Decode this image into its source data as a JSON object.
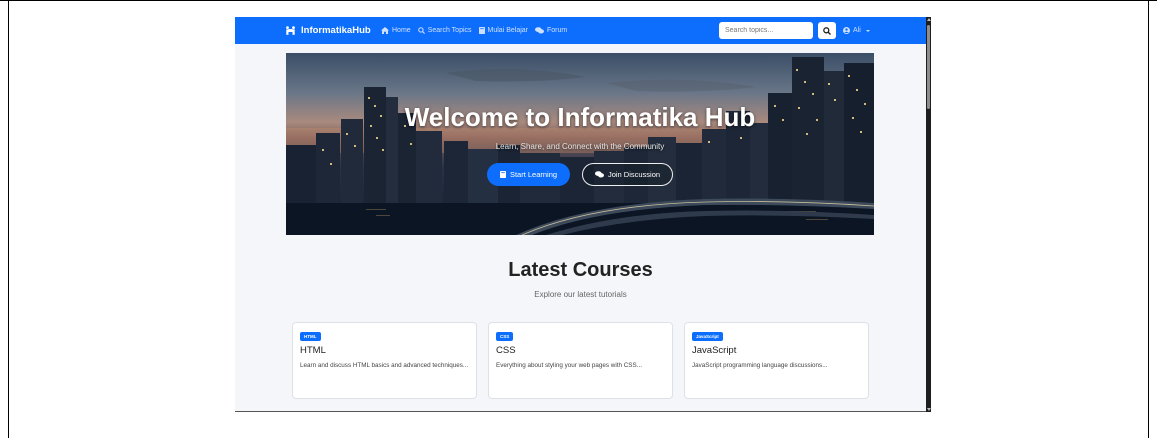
{
  "navbar": {
    "brand": "InformatikaHub",
    "links": [
      {
        "label": "Home",
        "icon": "home-icon"
      },
      {
        "label": "Search Topics",
        "icon": "search-icon"
      },
      {
        "label": "Mulai Belajar",
        "icon": "book-icon"
      },
      {
        "label": "Forum",
        "icon": "comments-icon"
      }
    ],
    "search_placeholder": "Search topics...",
    "user": "Ali",
    "colors": {
      "background": "#0d6efd"
    }
  },
  "hero": {
    "title": "Welcome to Informatika Hub",
    "subtitle": "Learn, Share, and Connect with the Community",
    "primary_button": "Start Learning",
    "secondary_button": "Join Discussion"
  },
  "courses": {
    "title": "Latest Courses",
    "subtitle": "Explore our latest tutorials",
    "items": [
      {
        "badge": "HTML",
        "title": "HTML",
        "description": "Learn and discuss HTML basics and advanced techniques..."
      },
      {
        "badge": "CSS",
        "title": "CSS",
        "description": "Everything about styling your web pages with CSS..."
      },
      {
        "badge": "JavaScript",
        "title": "JavaScript",
        "description": "JavaScript programming language discussions..."
      }
    ]
  }
}
